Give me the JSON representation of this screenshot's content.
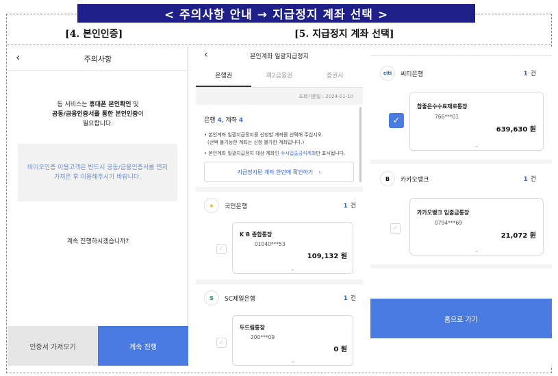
{
  "banner": {
    "title": "< 주의사항 안내 → 지급정지 계좌 선택 >"
  },
  "sections": {
    "left": "[4. 본인인증]",
    "right": "[5. 지급정지 계좌 선택]"
  },
  "screen1": {
    "back_icon": "chevron-left-icon",
    "title": "주의사항",
    "intro": {
      "p1": "동 서비스는 ",
      "b1": "휴대폰 본인확인",
      "p2": " 및",
      "b2": "공동/금융인증서를 통한 본인인증",
      "p3": "이",
      "line3": "필요합니다."
    },
    "notice": "바이오인증 이용고객은 반드시 공동/금융인증서를 먼저 가져온 후 이용해주시기 바랍니다.",
    "question": "계속 진행하시겠습니까?",
    "btn_cert": "인증서 가져오기",
    "btn_continue": "계속 진행"
  },
  "screen2": {
    "title": "본인계좌 일괄지급정지",
    "tabs": [
      {
        "label": "은행권",
        "active": true
      },
      {
        "label": "제2금융권",
        "active": false
      },
      {
        "label": "증권사",
        "active": false
      }
    ],
    "date": "조회기준일 : 2024-01-10",
    "count": {
      "bank_label": "은행",
      "bank_num": "4",
      "sep": ",",
      "acct_label": "계좌",
      "acct_num": "4"
    },
    "note1a": "• 본인계좌 일괄지급정지를 신청할 계좌를 선택해 주십시오.",
    "note1b": "(선택 불가능한 계좌는 신청 불가한 계좌입니다.)",
    "note2_pre": "• 본인계좌 일괄지급정지 대상 계좌인 ",
    "note2_link": "수시입출금식계좌",
    "note2_post": "만 표시됩니다.",
    "check_button": "지급정지된 계좌 한번에 확인하기",
    "check_button_icon": "chevron-right-icon",
    "banks": [
      {
        "logo_text": "★",
        "name": "국민은행",
        "count": "1",
        "unit": "건",
        "account": {
          "name": "K B 종합통장",
          "number": "01040***53",
          "balance": "109,132 원",
          "checked": false
        }
      },
      {
        "logo_text": "S",
        "name": "SC제일은행",
        "count": "1",
        "unit": "건",
        "account": {
          "name": "두드림통장",
          "number": "200***09",
          "balance": "0 원",
          "checked": false
        }
      }
    ]
  },
  "screen3": {
    "banks": [
      {
        "logo_text": "citi",
        "name": "씨티은행",
        "count": "1",
        "unit": "건",
        "account": {
          "name": "참좋은수수료제로통장",
          "number": "766***01",
          "balance": "639,630 원",
          "checked": true
        }
      },
      {
        "logo_text": "B",
        "name": "카카오뱅크",
        "count": "1",
        "unit": "건",
        "account": {
          "name": "카카오뱅크 입출금통장",
          "number": "0794***69",
          "balance": "21,072 원",
          "checked": false
        }
      }
    ],
    "home_button": "홈으로 가기"
  },
  "colors": {
    "banner_bg": "#1f1f8a",
    "accent": "#4a7be0",
    "link": "#3a68d0",
    "notice_text": "#6a8fd0"
  }
}
